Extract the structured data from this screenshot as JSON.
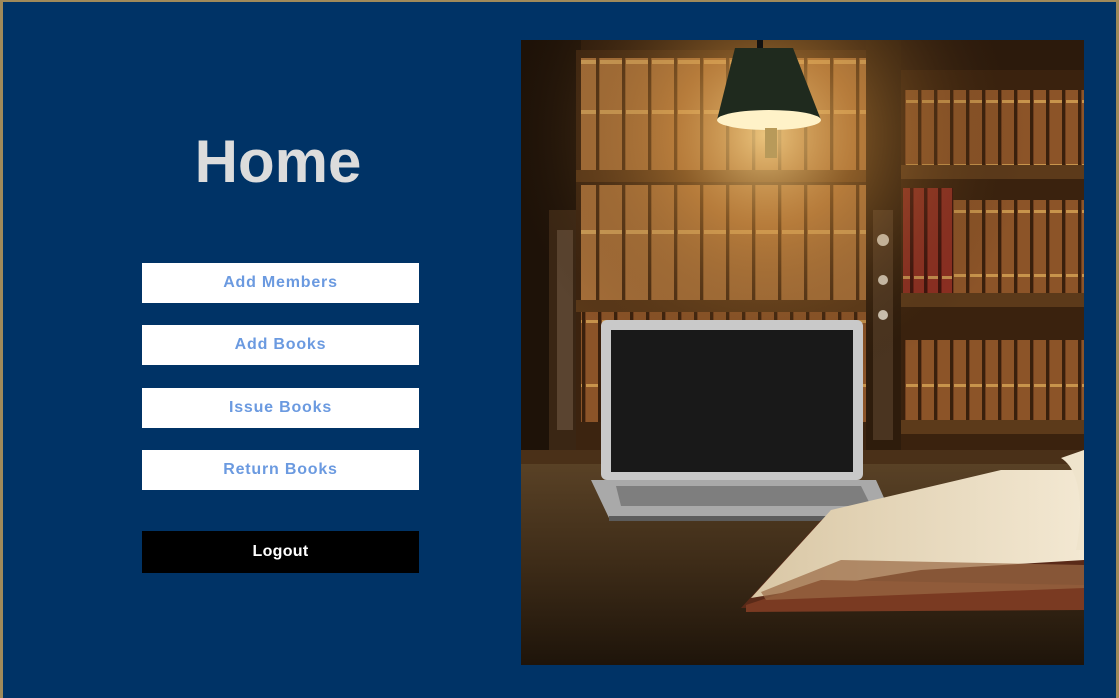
{
  "window": {
    "background": "#003366"
  },
  "page": {
    "title": "Home"
  },
  "menu": {
    "add_members_label": "Add Members",
    "add_books_label": "Add Books",
    "issue_books_label": "Issue Books",
    "return_books_label": "Return Books",
    "logout_label": "Logout",
    "button_text_color": "#6b9ae0"
  },
  "hero_image": {
    "subject": "library-bookshelves-laptop-open-book"
  }
}
